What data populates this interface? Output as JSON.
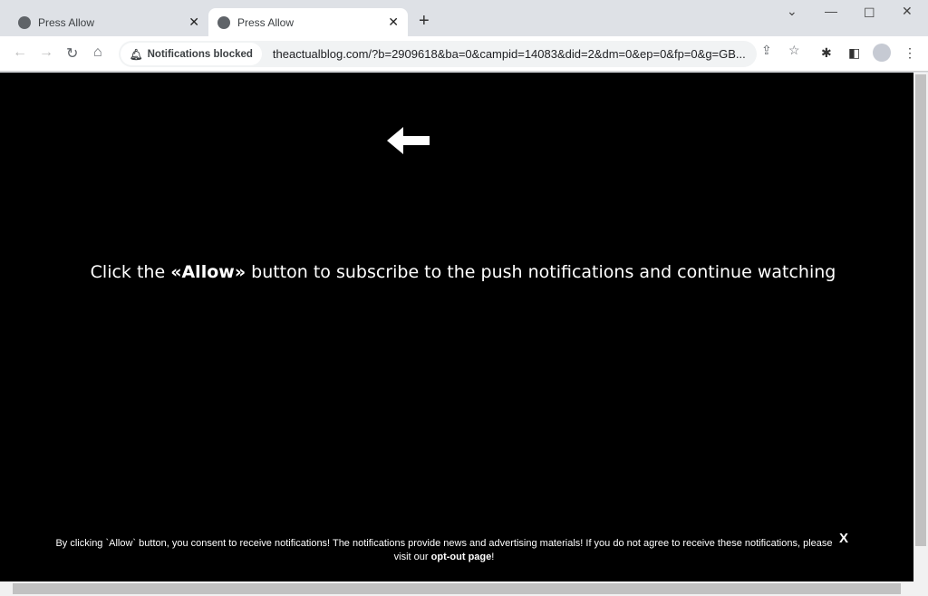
{
  "tabs": [
    {
      "title": "Press Allow",
      "active": false
    },
    {
      "title": "Press Allow",
      "active": true
    }
  ],
  "toolbar": {
    "notification_chip": "Notifications blocked",
    "url": "theactualblog.com/?b=2909618&ba=0&campid=14083&did=2&dm=0&ep=0&fp=0&g=GB..."
  },
  "page": {
    "headline_pre": "Click the ",
    "headline_bold": "«Allow»",
    "headline_post": " button to subscribe to the push notifications and continue watching",
    "consent_text": "By clicking `Allow` button, you consent to receive notifications! The notifications provide news and advertising materials! If you do not agree to receive these notifications, please visit our ",
    "consent_link": "opt-out page",
    "consent_end": "!",
    "close_label": "X"
  }
}
